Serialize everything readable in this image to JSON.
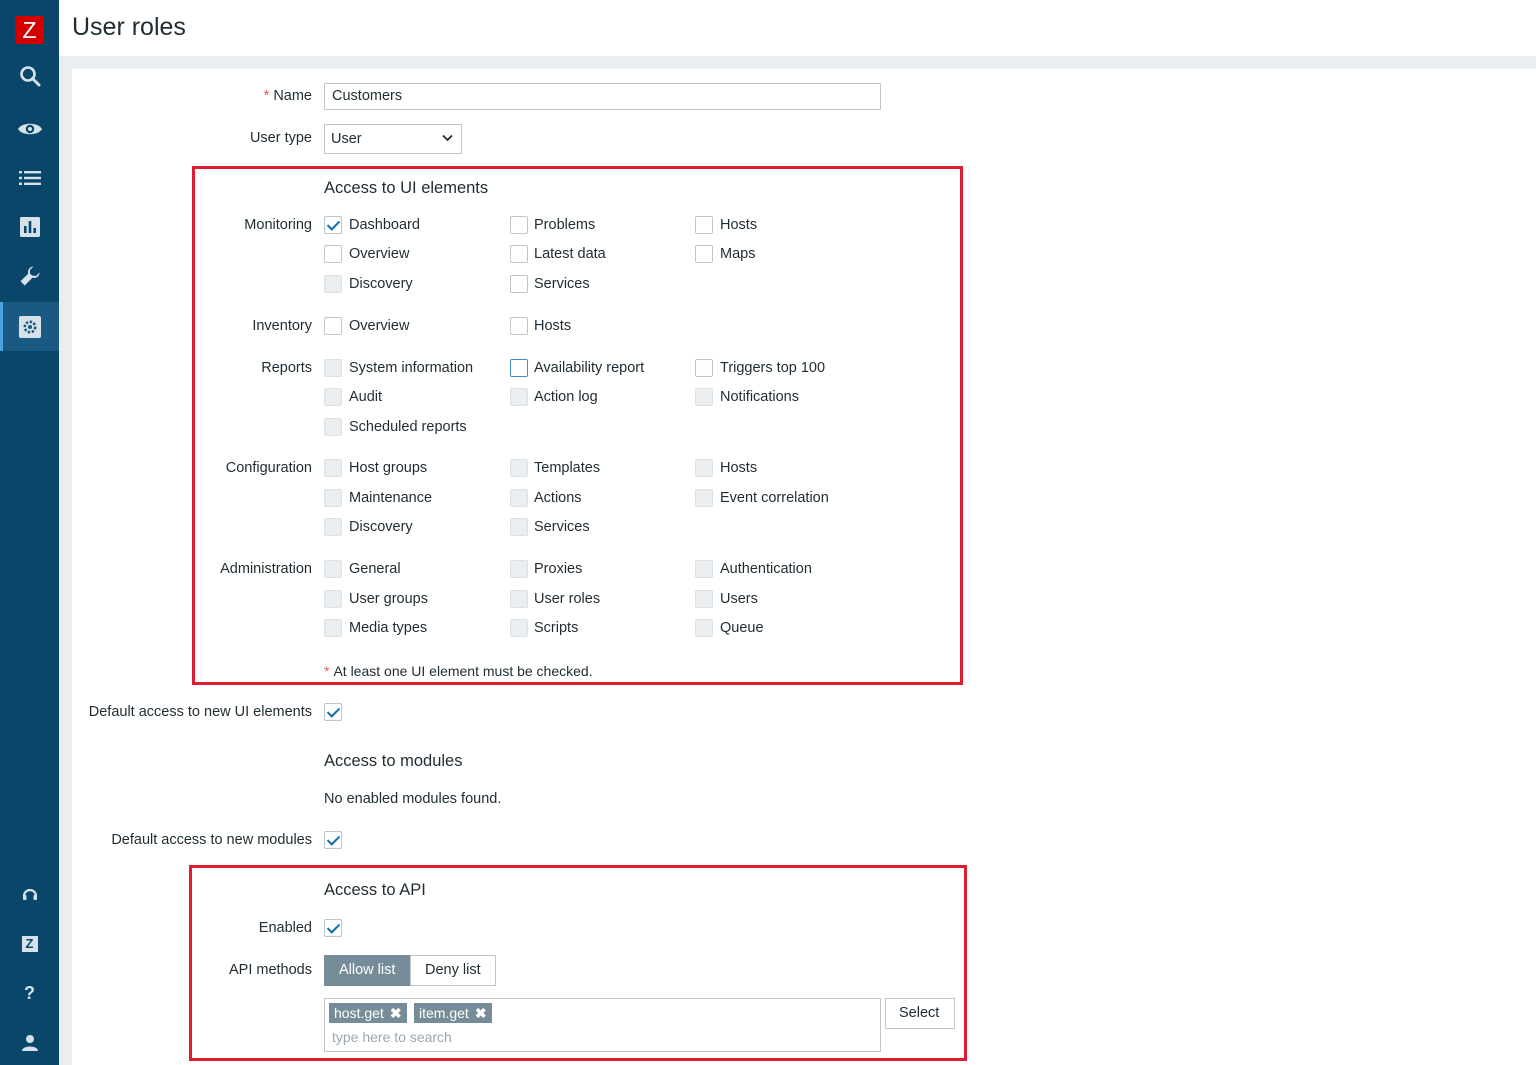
{
  "app": {
    "logo_letter": "Z"
  },
  "sidebar": {
    "items": [
      {
        "icon": "search-icon"
      },
      {
        "icon": "eye-icon"
      },
      {
        "icon": "list-icon"
      },
      {
        "icon": "chart-icon"
      },
      {
        "icon": "wrench-icon"
      },
      {
        "icon": "gear-icon",
        "active": true
      }
    ],
    "bottom_items": [
      {
        "icon": "headset-icon"
      },
      {
        "icon": "zabbix-share-icon",
        "text": "Z"
      },
      {
        "icon": "help-icon",
        "text": "?"
      },
      {
        "icon": "user-icon"
      }
    ]
  },
  "header": {
    "title": "User roles"
  },
  "form": {
    "name_label": "Name",
    "name_required_mark": "*",
    "name_value": "Customers",
    "user_type_label": "User type",
    "user_type_value": "User",
    "ui_section_title": "Access to UI elements",
    "groups": {
      "monitoring": "Monitoring",
      "inventory": "Inventory",
      "reports": "Reports",
      "configuration": "Configuration",
      "administration": "Administration"
    },
    "ui": {
      "mon_dashboard": "Dashboard",
      "mon_problems": "Problems",
      "mon_hosts": "Hosts",
      "mon_overview": "Overview",
      "mon_latest": "Latest data",
      "mon_maps": "Maps",
      "mon_discovery": "Discovery",
      "mon_services": "Services",
      "inv_overview": "Overview",
      "inv_hosts": "Hosts",
      "rep_sysinfo": "System information",
      "rep_avail": "Availability report",
      "rep_triggers": "Triggers top 100",
      "rep_audit": "Audit",
      "rep_actionlog": "Action log",
      "rep_notifications": "Notifications",
      "rep_scheduled": "Scheduled reports",
      "conf_hostgroups": "Host groups",
      "conf_templates": "Templates",
      "conf_hosts": "Hosts",
      "conf_maintenance": "Maintenance",
      "conf_actions": "Actions",
      "conf_eventcorr": "Event correlation",
      "conf_discovery": "Discovery",
      "conf_services": "Services",
      "adm_general": "General",
      "adm_proxies": "Proxies",
      "adm_auth": "Authentication",
      "adm_usergroups": "User groups",
      "adm_userroles": "User roles",
      "adm_users": "Users",
      "adm_mediatypes": "Media types",
      "adm_scripts": "Scripts",
      "adm_queue": "Queue"
    },
    "ui_note_mark": "*",
    "ui_note": "At least one UI element must be checked.",
    "default_ui_label": "Default access to new UI elements",
    "modules_section_title": "Access to modules",
    "modules_empty": "No enabled modules found.",
    "default_modules_label": "Default access to new modules",
    "api_section_title": "Access to API",
    "api_enabled_label": "Enabled",
    "api_methods_label": "API methods",
    "api_allow": "Allow list",
    "api_deny": "Deny list",
    "api_tags": [
      "host.get",
      "item.get"
    ],
    "api_tag_remove": "✖",
    "api_search_placeholder": "type here to search",
    "api_select_button": "Select"
  },
  "colors": {
    "sidebar_bg": "#0a466a",
    "highlight_border": "#dc1e30",
    "tag_bg": "#768d99",
    "logo_red": "#d40000"
  }
}
